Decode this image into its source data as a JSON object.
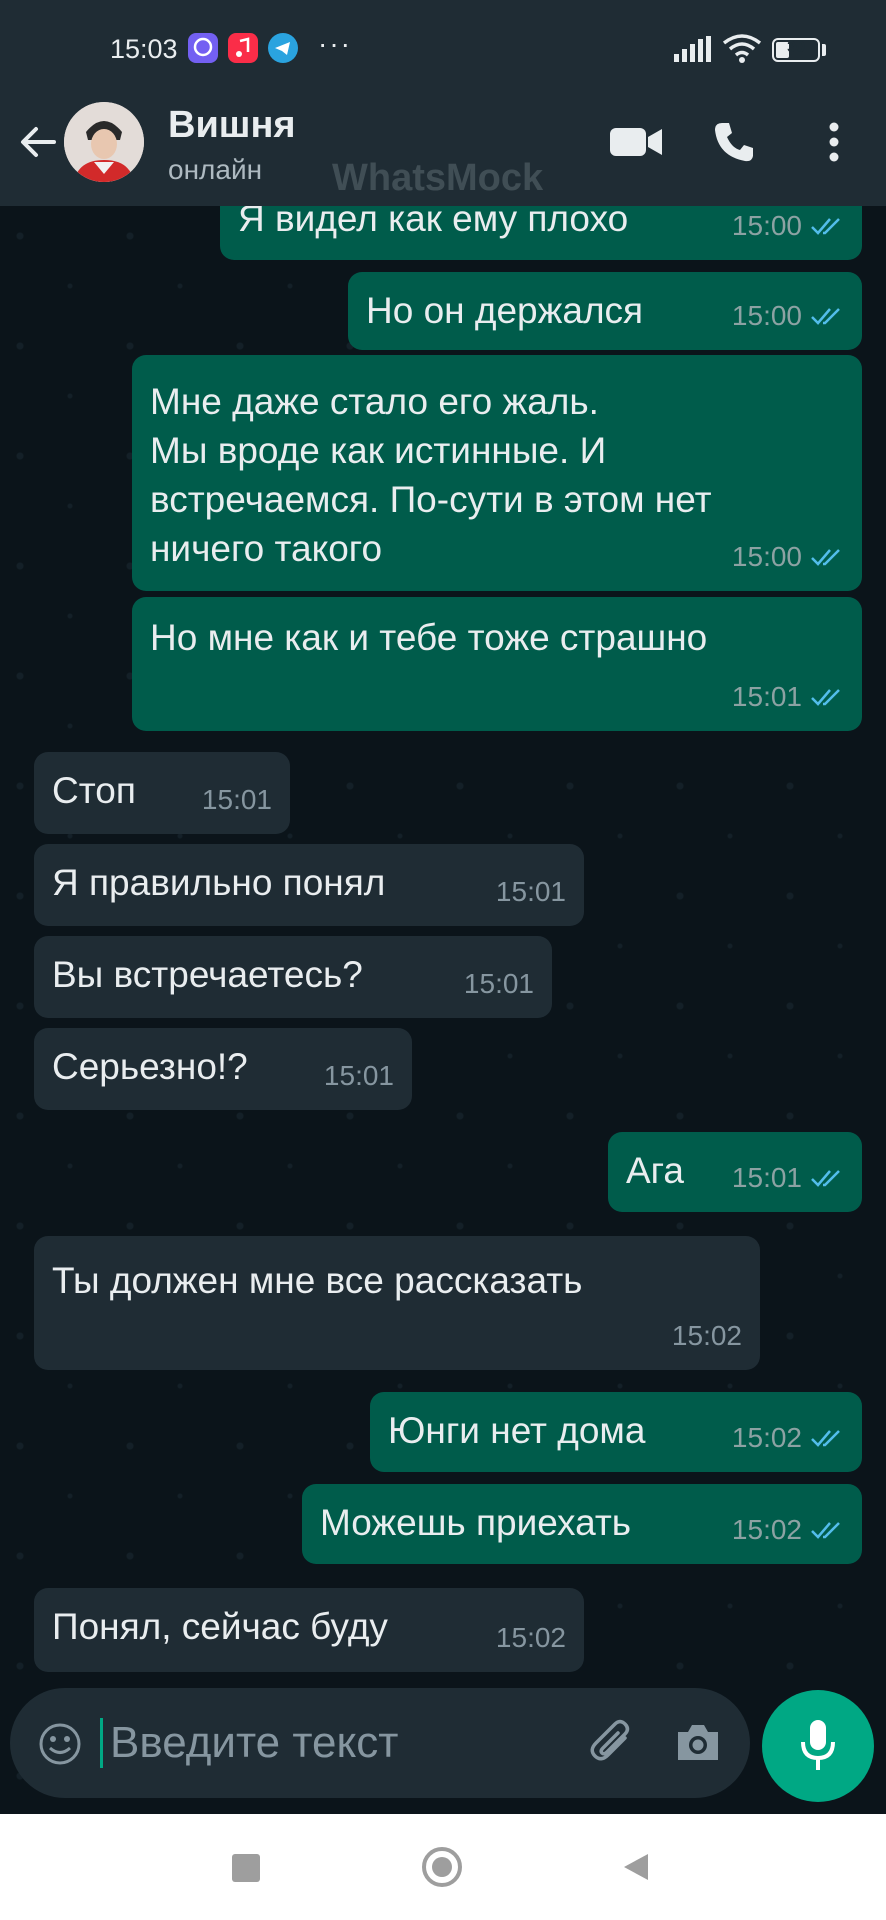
{
  "status_bar": {
    "time": "15:03",
    "dots": "···",
    "battery": "30"
  },
  "header": {
    "name": "Вишня",
    "status": "онлайн"
  },
  "watermark": "WhatsMock",
  "messages": [
    {
      "dir": "out",
      "text": "Я видел как ему плохо",
      "time": "15:00"
    },
    {
      "dir": "out",
      "text": "Но он держался",
      "time": "15:00"
    },
    {
      "dir": "out",
      "text": "Мне даже стало его жаль.\nМы вроде как истинные. И встречаемся. По-сути в этом нет ничего такого",
      "time": "15:00"
    },
    {
      "dir": "out",
      "text": "Но мне как и тебе тоже страшно",
      "time": "15:01"
    },
    {
      "dir": "in",
      "text": "Стоп",
      "time": "15:01"
    },
    {
      "dir": "in",
      "text": "Я правильно понял",
      "time": "15:01"
    },
    {
      "dir": "in",
      "text": "Вы встречаетесь?",
      "time": "15:01"
    },
    {
      "dir": "in",
      "text": "Серьезно!?",
      "time": "15:01"
    },
    {
      "dir": "out",
      "text": "Ага",
      "time": "15:01"
    },
    {
      "dir": "in",
      "text": "Ты должен мне все рассказать",
      "time": "15:02"
    },
    {
      "dir": "out",
      "text": "Юнги нет дома",
      "time": "15:02"
    },
    {
      "dir": "out",
      "text": "Можешь приехать",
      "time": "15:02"
    },
    {
      "dir": "in",
      "text": "Понял, сейчас буду",
      "time": "15:02"
    }
  ],
  "input": {
    "placeholder": "Введите текст"
  },
  "colors": {
    "outgoing": "#005c4b",
    "incoming": "#1f2c34",
    "accent": "#00a884",
    "read_ticks": "#53bdeb"
  }
}
